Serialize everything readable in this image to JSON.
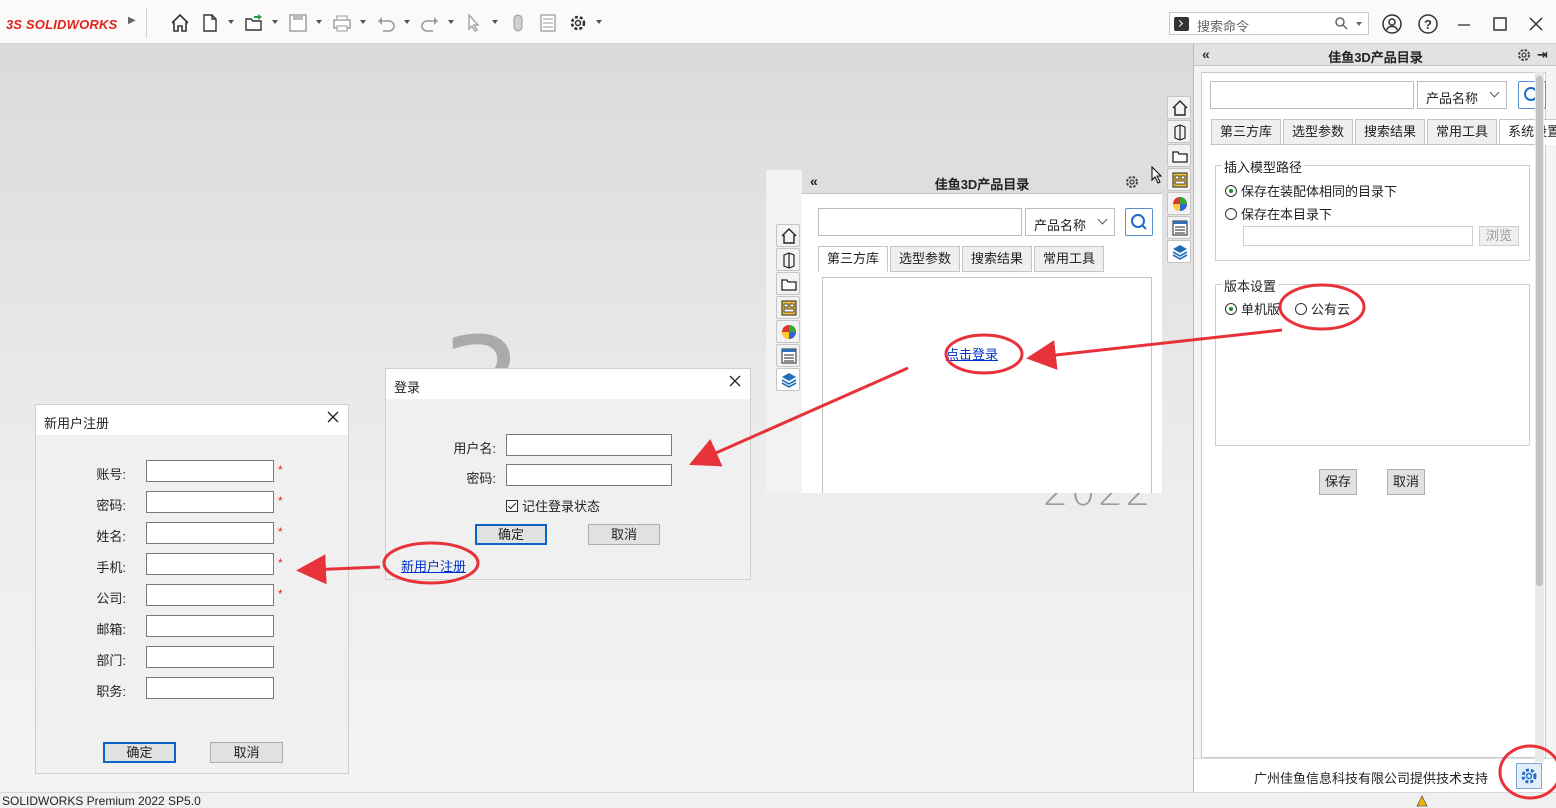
{
  "app": {
    "brand_mark": "3S",
    "brand_name": "SOLIDWORKS",
    "search_placeholder": "搜索命令",
    "status_text": "SOLIDWORKS Premium 2022 SP5.0"
  },
  "background": {
    "splash_year": "2022"
  },
  "task_pane": {
    "title": "佳鱼3D产品目录",
    "collapse_glyph": "«",
    "pin_glyph": "⇥",
    "search_select": "产品名称",
    "tabs": [
      "第三方库",
      "选型参数",
      "搜索结果",
      "常用工具",
      "系统设置"
    ],
    "active_tab": 4,
    "insert_group": {
      "legend": "插入模型路径",
      "option_same_dir": "保存在装配体相同的目录下",
      "option_this_dir": "保存在本目录下",
      "browse_label": "浏览"
    },
    "version_group": {
      "legend": "版本设置",
      "option_standalone": "单机版",
      "option_cloud": "公有云"
    },
    "save_label": "保存",
    "cancel_label": "取消",
    "footer_text": "广州佳鱼信息科技有限公司提供技术支持"
  },
  "floating_panel": {
    "title": "佳鱼3D产品目录",
    "collapse_glyph": "«",
    "search_select": "产品名称",
    "tabs": [
      "第三方库",
      "选型参数",
      "搜索结果",
      "常用工具"
    ],
    "active_tab": 0,
    "login_link": "点击登录"
  },
  "login_dialog": {
    "title": "登录",
    "username_label": "用户名:",
    "password_label": "密码:",
    "remember_label": "记住登录状态",
    "ok_label": "确定",
    "cancel_label": "取消",
    "register_link": "新用户注册"
  },
  "register_dialog": {
    "title": "新用户注册",
    "fields": [
      {
        "label": "账号:",
        "required": true
      },
      {
        "label": "密码:",
        "required": true
      },
      {
        "label": "姓名:",
        "required": true
      },
      {
        "label": "手机:",
        "required": true
      },
      {
        "label": "公司:",
        "required": true
      },
      {
        "label": "邮箱:",
        "required": false
      },
      {
        "label": "部门:",
        "required": false
      },
      {
        "label": "职务:",
        "required": false
      }
    ],
    "required_mark": "*",
    "ok_label": "确定",
    "cancel_label": "取消"
  },
  "colors": {
    "brand_red": "#e2231a",
    "annotation_red": "#e8323a",
    "link_blue": "#0033cc",
    "primary_border": "#0a64c8"
  },
  "icons": [
    "home-icon",
    "new-document-icon",
    "open-folder-icon",
    "save-icon",
    "print-icon",
    "undo-icon",
    "redo-icon",
    "select-pointer-icon",
    "rebuild-icon",
    "file-properties-icon",
    "options-gear-icon",
    "help-icon",
    "user-icon"
  ]
}
